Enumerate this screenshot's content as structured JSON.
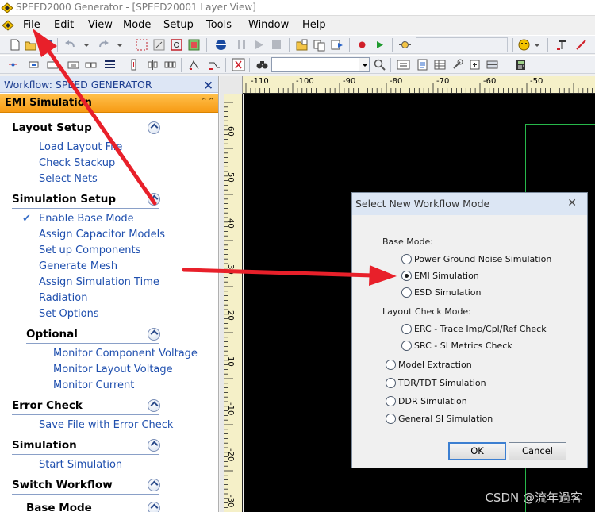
{
  "window": {
    "title": "SPEED2000 Generator - [SPEED20001 Layer View]"
  },
  "menu": [
    "File",
    "Edit",
    "View",
    "Mode",
    "Setup",
    "Tools",
    "Window",
    "Help"
  ],
  "panel": {
    "header": "Workflow: SPEED GENERATOR",
    "banner": "EMI Simulation",
    "sections": [
      {
        "title": "Layout Setup",
        "items": [
          "Load Layout File",
          "Check Stackup",
          "Select Nets"
        ]
      },
      {
        "title": "Simulation Setup",
        "items": [
          "Enable Base Mode",
          "Assign Capacitor Models",
          "Set up Components",
          "Generate Mesh",
          "Assign Simulation Time",
          "Radiation",
          "Set Options"
        ]
      },
      {
        "title": "Optional",
        "items": [
          "Monitor Component Voltage",
          "Monitor Layout Voltage",
          "Monitor Current"
        ]
      },
      {
        "title": "Error Check",
        "items": [
          "Save File with Error Check"
        ]
      },
      {
        "title": "Simulation",
        "items": [
          "Start Simulation"
        ]
      },
      {
        "title": "Switch Workflow",
        "items": []
      },
      {
        "title": "Base Mode",
        "items": []
      }
    ]
  },
  "ruler": {
    "horizontal": [
      "-110",
      "-100",
      "-90",
      "-80",
      "-70",
      "-60",
      "-50"
    ],
    "vertical": [
      "60",
      "50",
      "40",
      "30",
      "20",
      "10",
      "0",
      "-10",
      "-20",
      "-30"
    ]
  },
  "dialog": {
    "title": "Select New Workflow Mode",
    "base_mode_label": "Base Mode:",
    "base_options": [
      "Power Ground Noise Simulation",
      "EMI Simulation",
      "ESD Simulation"
    ],
    "base_selected": "EMI Simulation",
    "layout_check_label": "Layout Check Mode:",
    "layout_options": [
      "ERC - Trace Imp/Cpl/Ref Check",
      "SRC - SI Metrics Check"
    ],
    "other_options": [
      "Model Extraction",
      "TDR/TDT Simulation",
      "DDR Simulation",
      "General SI Simulation"
    ],
    "ok_label": "OK",
    "cancel_label": "Cancel"
  },
  "colors": {
    "annotation_arrow": "#e8202a",
    "panel_banner": "#f7a51f",
    "link": "#1f4fae",
    "trace": "#27b84a"
  },
  "watermark": "CSDN @流年過客"
}
